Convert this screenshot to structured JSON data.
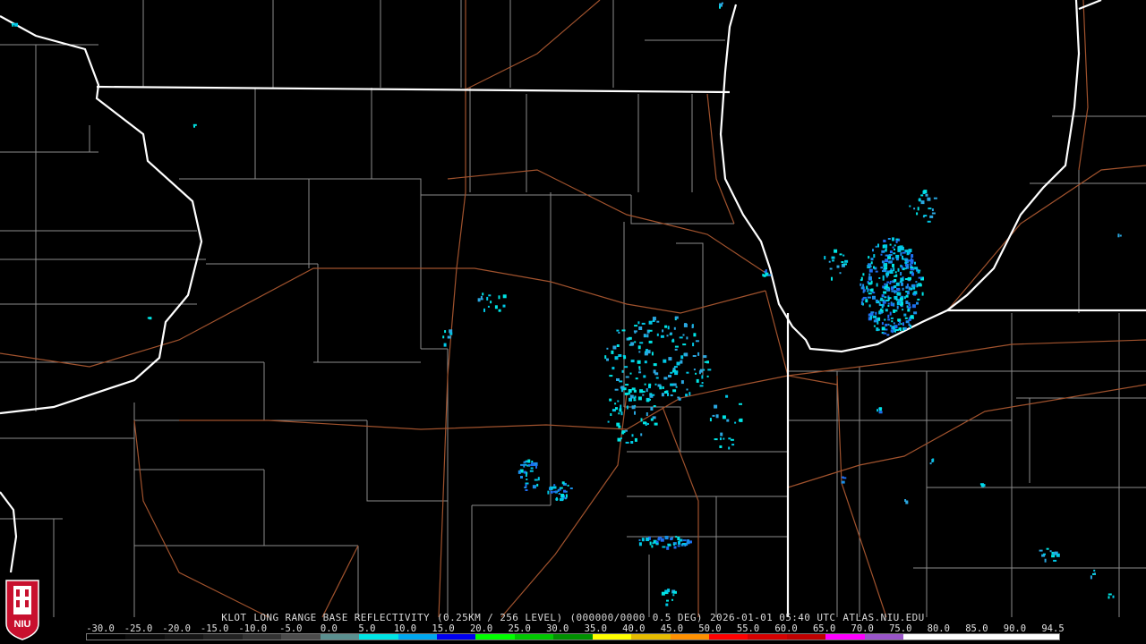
{
  "title": {
    "station": "KLOT",
    "product": "LONG RANGE BASE REFLECTIVITY",
    "resolution": "(0.25KM / 256 LEVEL)",
    "volume": "(000000/0000",
    "elevation": "0.5 DEG)",
    "datetime": "2026-01-01 05:40 UTC",
    "source": "ATLAS.NIU.EDU"
  },
  "scale": {
    "labels": [
      "-30.0",
      "-25.0",
      "-20.0",
      "-15.0",
      "-10.0",
      "-5.0",
      "0.0",
      "5.0",
      "10.0",
      "15.0",
      "20.0",
      "25.0",
      "30.0",
      "35.0",
      "40.0",
      "45.0",
      "50.0",
      "55.0",
      "60.0",
      "65.0",
      "70.0",
      "75.0",
      "80.0",
      "85.0",
      "90.0",
      "94.5"
    ],
    "colors": [
      "#000000",
      "#0a0a0a",
      "#151515",
      "#222222",
      "#333333",
      "#4b4b4b",
      "#5a8f8f",
      "#00e5e5",
      "#00a8f0",
      "#0000f0",
      "#00ff00",
      "#00c800",
      "#009000",
      "#ffff00",
      "#e6bc00",
      "#ff9000",
      "#ff0000",
      "#d60000",
      "#c00000",
      "#ff00ff",
      "#9955c9",
      "#ffffff",
      "#ffffff",
      "#ffffff",
      "#ffffff"
    ]
  },
  "logo": {
    "text": "NIU",
    "color": "#c8102e"
  },
  "colors": {
    "state_border": "#ffffff",
    "county_border": "#8c8c8c",
    "highway": "#a0522d",
    "echo_light": "#00c8e6",
    "echo_blue": "#1e6ef0"
  }
}
